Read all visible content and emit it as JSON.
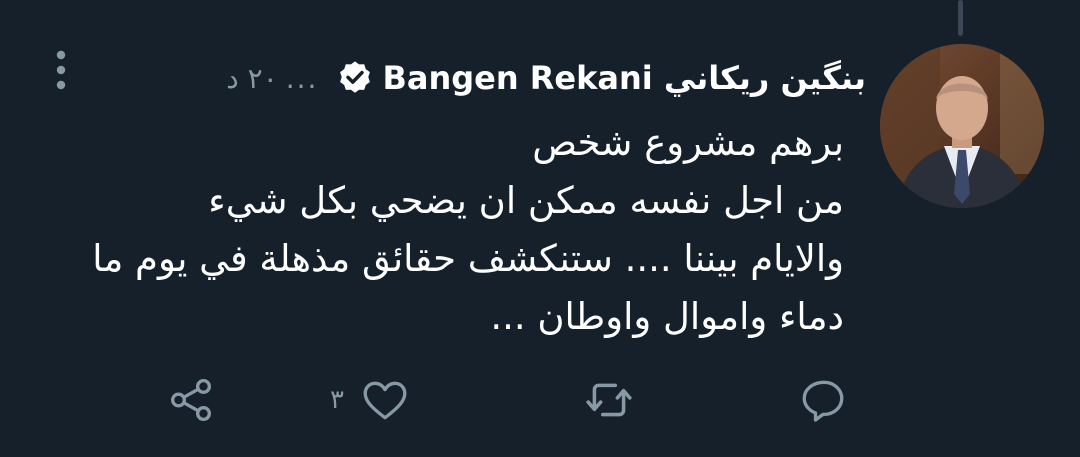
{
  "tweet": {
    "display_name": "بنگین ريكاني Bangen Rekani",
    "verified_icon": "verified-badge-icon",
    "more_dots": "...",
    "time_ago": "٢٠ د",
    "lines": [
      "برهم مشروع شخص",
      "من اجل نفسه ممكن ان يضحي بكل شيء",
      "والايام بيننا .... ستنكشف حقائق مذهلة في يوم ما",
      "دماء واموال واوطان ..."
    ]
  },
  "actions": {
    "reply_icon": "reply-icon",
    "retweet_icon": "retweet-icon",
    "like_icon": "heart-icon",
    "like_count": "٣",
    "share_icon": "share-icon"
  },
  "colors": {
    "background": "#15202b",
    "text": "#ffffff",
    "muted": "#8899a6",
    "thread_line": "#3b4754"
  }
}
